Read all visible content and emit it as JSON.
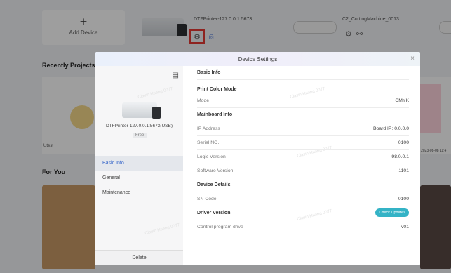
{
  "background": {
    "add_device_label": "Add Device",
    "add_device_plus": "+",
    "devices": [
      {
        "name": "DTFPrinter-127.0.0.1:5673"
      },
      {
        "name": "C2_CuttingMachine_0013"
      }
    ],
    "recent_projects_title": "Recently Projects",
    "recent_project_label": "Utest",
    "recent_project_date": "2023-08-08 11:4",
    "for_you_title": "For You"
  },
  "modal": {
    "title": "Device Settings",
    "close": "×",
    "device": {
      "full_name": "DTFPrinter-127.0.0.1:5673(USB)",
      "status": "Free"
    },
    "menu": [
      {
        "label": "Basic Info"
      },
      {
        "label": "General"
      },
      {
        "label": "Maintenance"
      }
    ],
    "delete_label": "Delete",
    "content_title": "Basic Info",
    "sections": {
      "print_color_mode": {
        "title": "Print Color Mode",
        "mode_key": "Mode",
        "mode_value": "CMYK"
      },
      "mainboard": {
        "title": "Mainboard Info",
        "ip_key": "IP Address",
        "ip_value": "Board IP: 0.0.0.0",
        "serial_key": "Serial NO.",
        "serial_value": "0100",
        "logic_key": "Logic Version",
        "logic_value": "98.0.0.1",
        "software_key": "Software Version",
        "software_value": "1101"
      },
      "device_details": {
        "title": "Device Details",
        "sn_key": "SN Code",
        "sn_value": "0100"
      },
      "driver": {
        "title": "Driver Version",
        "check_button": "Check Updates",
        "drive_key": "Control program drive",
        "drive_value": "v01"
      }
    },
    "watermark_text": "Clavin Huang 0077"
  },
  "colors": {
    "accent_blue": "#3565c9",
    "check_button": "#34b3c6",
    "highlight_border": "#e53935"
  }
}
